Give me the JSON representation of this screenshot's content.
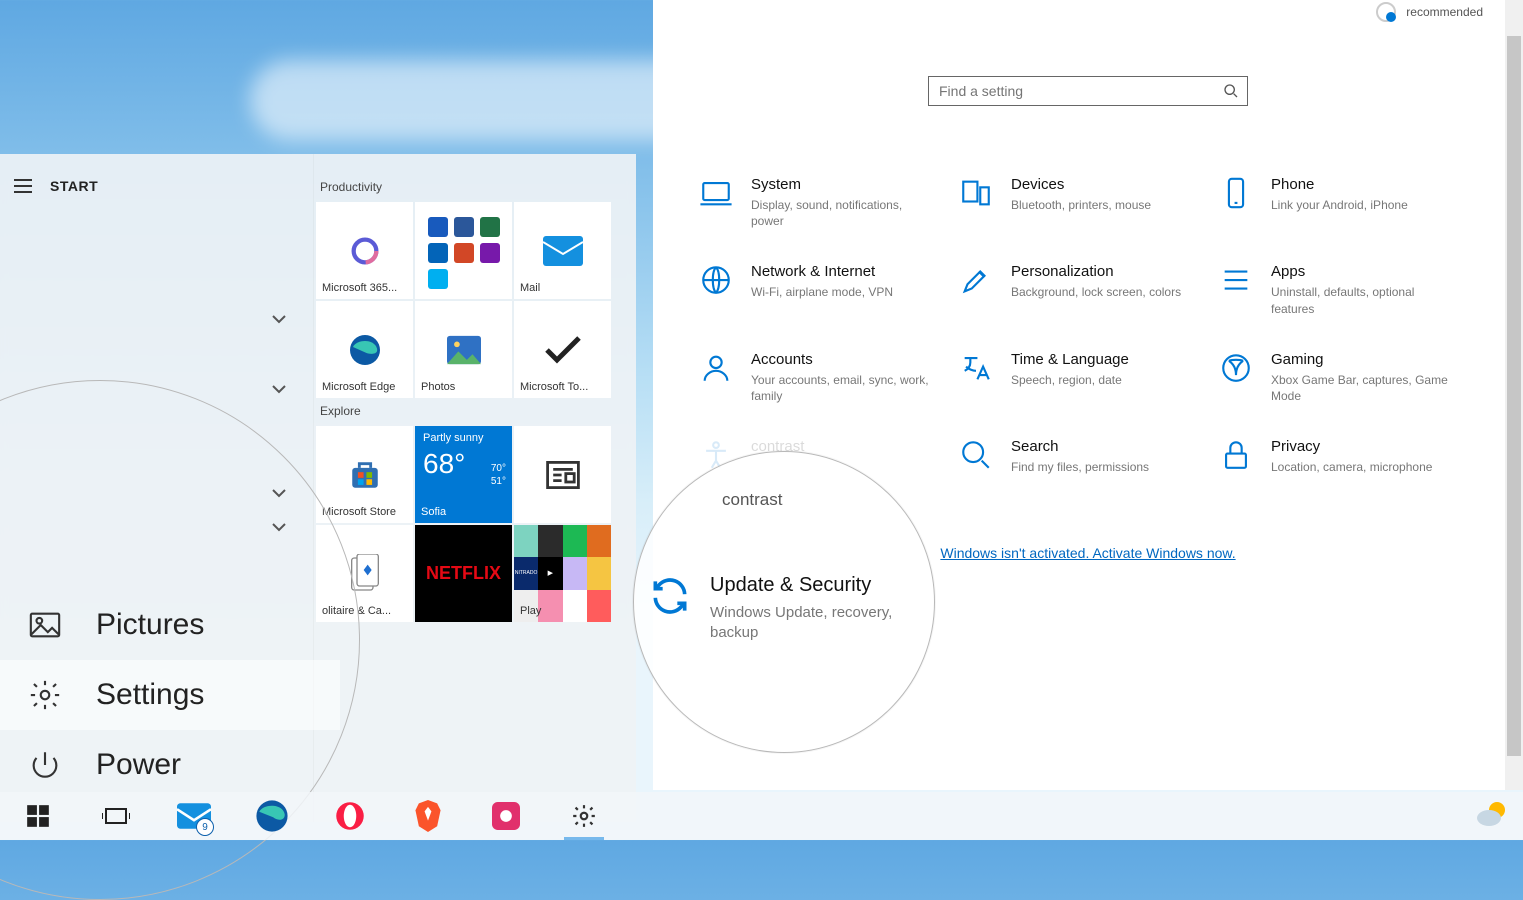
{
  "taskbar": {
    "mail_badge": "9"
  },
  "start": {
    "label": "START",
    "rail": {
      "pictures": "Pictures",
      "settings": "Settings",
      "power": "Power"
    },
    "groups": {
      "productivity": {
        "title": "Productivity",
        "tiles": {
          "m365": "Microsoft 365...",
          "mail": "Mail",
          "edge": "Microsoft Edge",
          "photos": "Photos",
          "todo": "Microsoft To..."
        }
      },
      "explore": {
        "title": "Explore",
        "tiles": {
          "store": "Microsoft Store",
          "weather": {
            "condition": "Partly sunny",
            "temp": "68°",
            "high": "70°",
            "low": "51°",
            "city": "Sofia"
          },
          "news": "",
          "solitaire": "olitaire & Ca...",
          "netflix": "NETFLIX",
          "play": "Play"
        }
      }
    }
  },
  "settings": {
    "top_note": "recommended",
    "search_placeholder": "Find a setting",
    "categories": {
      "system": {
        "title": "System",
        "desc": "Display, sound, notifications, power"
      },
      "devices": {
        "title": "Devices",
        "desc": "Bluetooth, printers, mouse"
      },
      "phone": {
        "title": "Phone",
        "desc": "Link your Android, iPhone"
      },
      "network": {
        "title": "Network & Internet",
        "desc": "Wi-Fi, airplane mode, VPN"
      },
      "personalization": {
        "title": "Personalization",
        "desc": "Background, lock screen, colors"
      },
      "apps": {
        "title": "Apps",
        "desc": "Uninstall, defaults, optional features"
      },
      "accounts": {
        "title": "Accounts",
        "desc": "Your accounts, email, sync, work, family"
      },
      "time": {
        "title": "Time & Language",
        "desc": "Speech, region, date"
      },
      "gaming": {
        "title": "Gaming",
        "desc": "Xbox Game Bar, captures, Game Mode"
      },
      "ease": {
        "title": "contrast",
        "desc": ""
      },
      "search": {
        "title": "Search",
        "desc": "Find my files, permissions"
      },
      "privacy": {
        "title": "Privacy",
        "desc": "Location, camera, microphone"
      }
    },
    "activation_link": "Windows isn't activated. Activate Windows now."
  },
  "magnifier": {
    "contrast_peek": "contrast",
    "update": {
      "title": "Update & Security",
      "desc": "Windows Update, recovery, backup"
    }
  }
}
